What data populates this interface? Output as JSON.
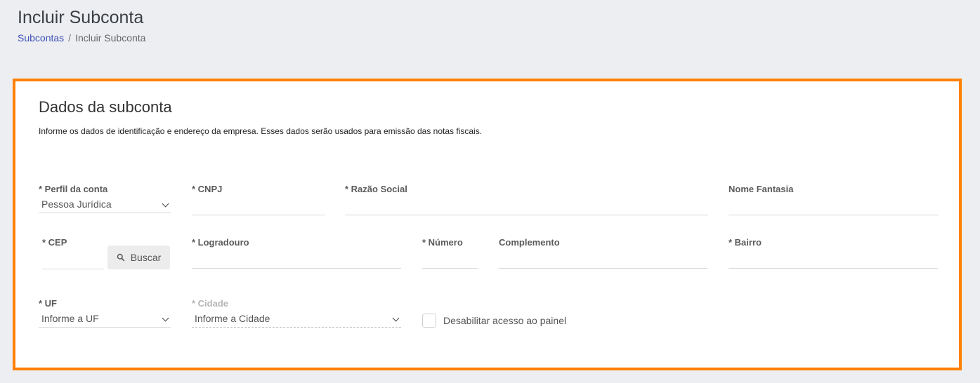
{
  "header": {
    "title": "Incluir Subconta",
    "breadcrumb": {
      "link": "Subcontas",
      "separator": "/",
      "current": "Incluir Subconta"
    }
  },
  "card": {
    "title": "Dados da subconta",
    "description": "Informe os dados de identificação e endereço da empresa. Esses dados serão usados para emissão das notas fiscais.",
    "border_color": "#ff8000"
  },
  "form": {
    "perfil": {
      "label": "* Perfil da conta",
      "value": "Pessoa Jurídica"
    },
    "cnpj": {
      "label": "* CNPJ",
      "value": ""
    },
    "razao_social": {
      "label": "* Razão Social",
      "value": ""
    },
    "nome_fantasia": {
      "label": "Nome Fantasia",
      "value": ""
    },
    "cep": {
      "label": "* CEP",
      "value": ""
    },
    "buscar_button": "Buscar",
    "logradouro": {
      "label": "* Logradouro",
      "value": ""
    },
    "numero": {
      "label": "* Número",
      "value": ""
    },
    "complemento": {
      "label": "Complemento",
      "value": ""
    },
    "bairro": {
      "label": "* Bairro",
      "value": ""
    },
    "uf": {
      "label": "* UF",
      "value": "Informe a UF"
    },
    "cidade": {
      "label": "* Cidade",
      "value": "Informe a Cidade"
    },
    "desabilitar": {
      "label": "Desabilitar acesso ao painel",
      "checked": false
    }
  }
}
